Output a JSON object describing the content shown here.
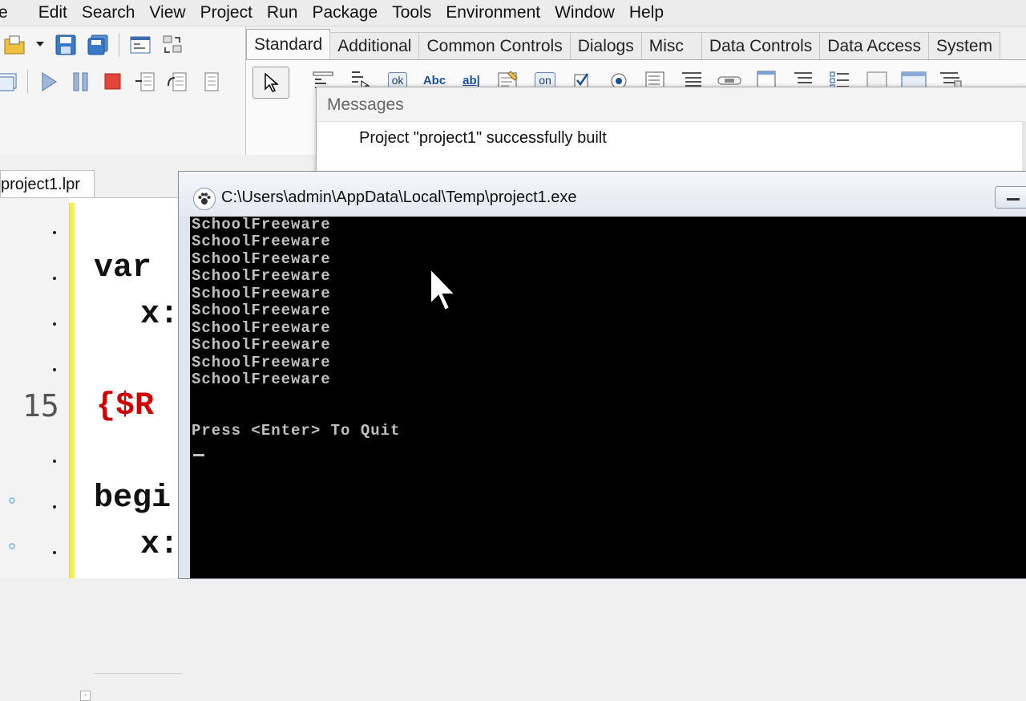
{
  "menu": [
    "e",
    "Edit",
    "Search",
    "View",
    "Project",
    "Run",
    "Package",
    "Tools",
    "Environment",
    "Window",
    "Help"
  ],
  "palette": {
    "tabs": [
      "Standard",
      "Additional",
      "Common Controls",
      "Dialogs",
      "Misc",
      "Data Controls",
      "Data Access",
      "System"
    ],
    "active_tab": "Standard",
    "component_icons": [
      "ok",
      "Abc",
      "ab|",
      "on"
    ]
  },
  "messages": {
    "title": "Messages",
    "text": "Project \"project1\" successfully built"
  },
  "editor": {
    "tab_label": "project1.lpr",
    "line_number": "15",
    "code_lines": [
      "var",
      "x:",
      "{$R",
      "begi",
      "x:"
    ]
  },
  "console": {
    "title": "C:\\Users\\admin\\AppData\\Local\\Temp\\project1.exe",
    "output_lines": [
      "SchoolFreeware",
      "SchoolFreeware",
      "SchoolFreeware",
      "SchoolFreeware",
      "SchoolFreeware",
      "SchoolFreeware",
      "SchoolFreeware",
      "SchoolFreeware",
      "SchoolFreeware",
      "SchoolFreeware"
    ],
    "prompt": "Press <Enter> To Quit"
  }
}
